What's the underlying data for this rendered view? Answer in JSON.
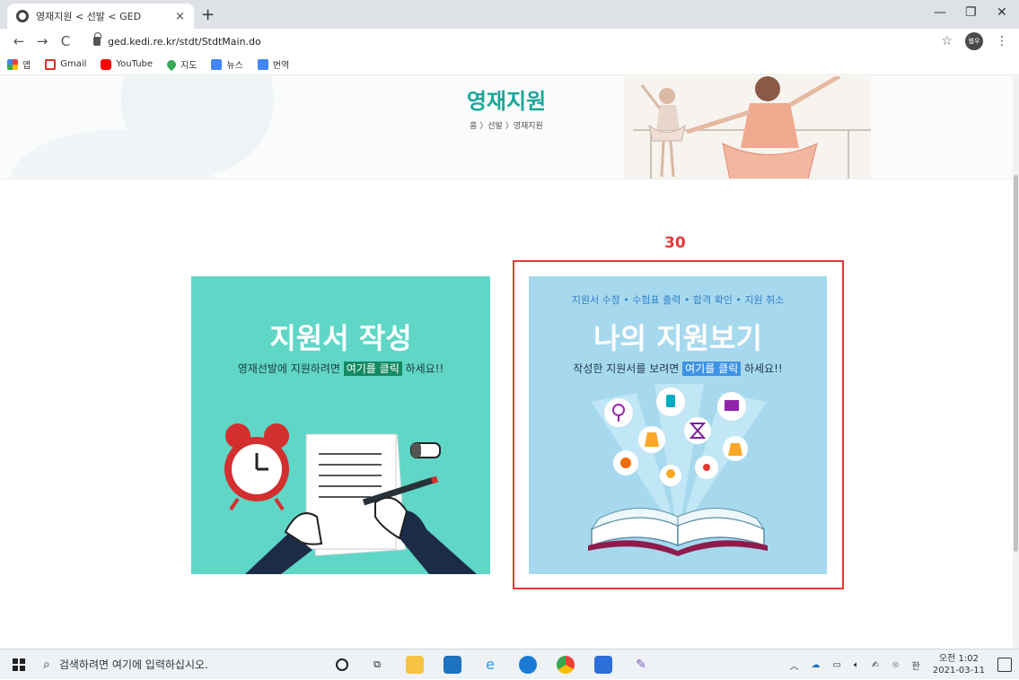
{
  "browser": {
    "tab_title": "영재지원 < 선발 < GED",
    "tab_close": "×",
    "new_tab": "+",
    "url": "ged.kedi.re.kr/stdt/StdtMain.do",
    "profile_initials": "웹우",
    "window_controls": {
      "minimize": "—",
      "restore": "❐",
      "close": "✕"
    },
    "nav": {
      "back": "←",
      "forward": "→",
      "reload": "C"
    },
    "bookmarks": [
      {
        "label": "앱",
        "icon": "apps-grid-icon",
        "color": "#e94235"
      },
      {
        "label": "Gmail",
        "icon": "gmail-icon",
        "color": "#d93025"
      },
      {
        "label": "YouTube",
        "icon": "youtube-icon",
        "color": "#ff0000"
      },
      {
        "label": "지도",
        "icon": "maps-pin-icon",
        "color": "#34a853"
      },
      {
        "label": "뉴스",
        "icon": "news-icon",
        "color": "#4285f4"
      },
      {
        "label": "번역",
        "icon": "translate-icon",
        "color": "#4285f4"
      }
    ]
  },
  "page": {
    "banner_title": "영재지원",
    "breadcrumb": "홈 〉선발 〉영재지원",
    "annotation_number": "30",
    "card_left": {
      "title": "지원서 작성",
      "desc_before": "영재선발에 지원하려면 ",
      "desc_highlight": "여기를 클릭",
      "desc_after": " 하세요!!",
      "bg_color": "#5fd6c6"
    },
    "card_right": {
      "sub": "지원서 수정 • 수험표 출력 • 합격 확인 • 지원 취소",
      "title": "나의 지원보기",
      "desc_before": "작성한 지원서를 보려면 ",
      "desc_highlight": "여기를 클릭",
      "desc_after": " 하세요!!",
      "bg_color": "#a7d9ee"
    },
    "accent_color": "#1aa79a",
    "annotation_color": "#e53935"
  },
  "taskbar": {
    "search_placeholder": "검색하려면 여기에 입력하십시오.",
    "clock_period_time": "오전 1:02",
    "clock_date": "2021-03-11",
    "ime": "한",
    "apps": [
      "cortana-icon",
      "task-view-icon",
      "file-explorer-icon",
      "mail-icon",
      "ie-icon",
      "edge-icon",
      "chrome-icon",
      "store-icon",
      "paint-icon"
    ]
  }
}
